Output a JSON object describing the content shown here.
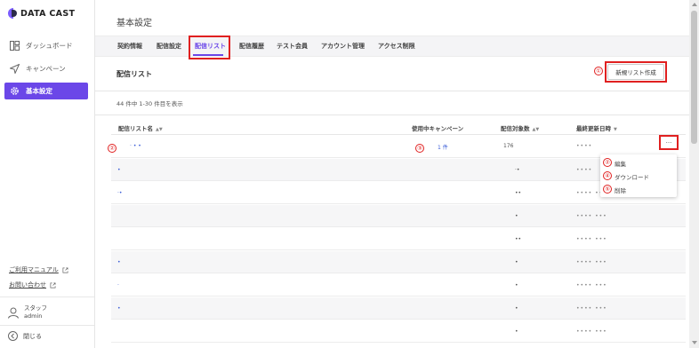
{
  "sidebar": {
    "logo_text": "DATA CAST",
    "items": [
      {
        "label": "ダッシュボード"
      },
      {
        "label": "キャンペーン"
      },
      {
        "label": "基本設定"
      }
    ],
    "manual_link": "ご利用マニュアル",
    "contact_link": "お問い合わせ",
    "staff_role": "スタッフ",
    "staff_name": "admin",
    "close_label": "閉じる"
  },
  "header": {
    "title": "基本設定"
  },
  "tabs": [
    {
      "label": "契約情報"
    },
    {
      "label": "配信設定"
    },
    {
      "label": "配信リスト"
    },
    {
      "label": "配信履歴"
    },
    {
      "label": "テスト会員"
    },
    {
      "label": "アカウント管理"
    },
    {
      "label": "アクセス制限"
    }
  ],
  "section": {
    "title": "配信リスト",
    "new_button": "新規リスト作成",
    "count_text": "44 件中 1-30 件目を表示"
  },
  "table": {
    "columns": [
      "配信リスト名",
      "使用中キャンペーン",
      "配信対象数",
      "最終更新日時"
    ],
    "first_row": {
      "name": "· • •",
      "campaign": "1 件",
      "count": "176",
      "updated": "••••"
    },
    "rows": [
      {
        "name": "•",
        "count": "·•",
        "updated": "••••"
      },
      {
        "name": "·•",
        "count": "••",
        "updated": "•••• •••"
      },
      {
        "name": "",
        "count": "•",
        "updated": "•••• •••"
      },
      {
        "name": "",
        "count": "••",
        "updated": "•••• •••"
      },
      {
        "name": "•",
        "count": "•",
        "updated": "•••• •••"
      },
      {
        "name": "·",
        "count": "•",
        "updated": "•••• •••"
      },
      {
        "name": "•",
        "count": "•",
        "updated": "•••• •••"
      },
      {
        "name": "",
        "count": "•",
        "updated": "•••• •••"
      }
    ]
  },
  "dropdown": {
    "items": [
      {
        "label": "編集"
      },
      {
        "label": "ダウンロード"
      },
      {
        "label": "削除"
      }
    ]
  },
  "more_label": "···",
  "annotations": {
    "one": "①",
    "two": "②",
    "three": "③",
    "four": "④",
    "five": "⑤"
  },
  "colors": {
    "accent": "#6b47e8",
    "highlight": "#e02020",
    "link": "#3d5fd8"
  }
}
